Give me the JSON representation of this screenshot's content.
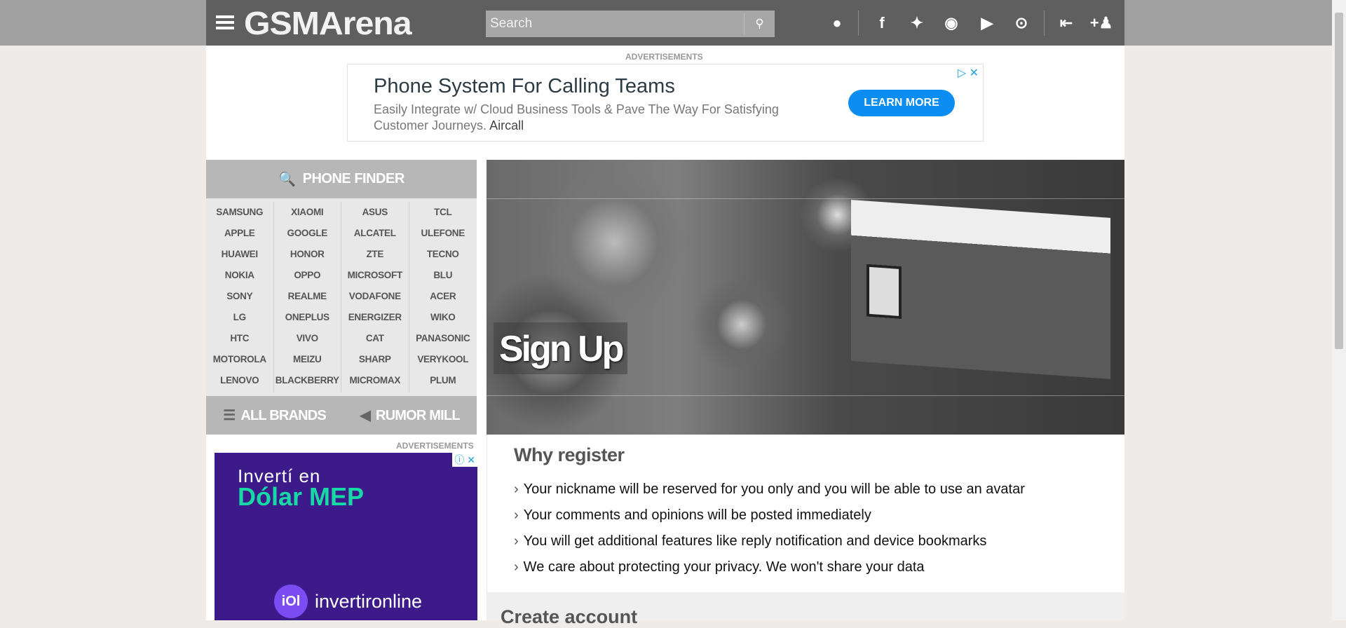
{
  "header": {
    "logo": "GSMArena",
    "search_placeholder": "Search",
    "icons": [
      "tip-icon",
      "facebook-icon",
      "twitter-icon",
      "instagram-icon",
      "youtube-icon",
      "rss-icon",
      "login-icon",
      "register-icon"
    ]
  },
  "top_ad": {
    "label": "ADVERTISEMENTS",
    "title": "Phone System For Calling Teams",
    "body": "Easily Integrate w/ Cloud Business Tools & Pave The Way For Satisfying Customer Journeys.",
    "advertiser": "Aircall",
    "cta": "LEARN MORE"
  },
  "phone_finder": {
    "title": "PHONE FINDER",
    "columns": [
      [
        "SAMSUNG",
        "APPLE",
        "HUAWEI",
        "NOKIA",
        "SONY",
        "LG",
        "HTC",
        "MOTOROLA",
        "LENOVO"
      ],
      [
        "XIAOMI",
        "GOOGLE",
        "HONOR",
        "OPPO",
        "REALME",
        "ONEPLUS",
        "VIVO",
        "MEIZU",
        "BLACKBERRY"
      ],
      [
        "ASUS",
        "ALCATEL",
        "ZTE",
        "MICROSOFT",
        "VODAFONE",
        "ENERGIZER",
        "CAT",
        "SHARP",
        "MICROMAX"
      ],
      [
        "TCL",
        "ULEFONE",
        "TECNO",
        "BLU",
        "ACER",
        "WIKO",
        "PANASONIC",
        "VERYKOOL",
        "PLUM"
      ]
    ],
    "all_brands": "ALL BRANDS",
    "rumor_mill": "RUMOR MILL"
  },
  "side_ad": {
    "label": "ADVERTISEMENTS",
    "line1": "Invertí en",
    "line2": "Dólar MEP",
    "brand": "invertironline",
    "brand_logo": "iOl"
  },
  "hero": {
    "title": "Sign Up"
  },
  "why": {
    "title": "Why register",
    "items": [
      "Your nickname will be reserved for you only and you will be able to use an avatar",
      "Your comments and opinions will be posted immediately",
      "You will get additional features like reply notification and device bookmarks",
      "We care about protecting your privacy. We won't share your data"
    ]
  },
  "create": {
    "title": "Create account"
  }
}
